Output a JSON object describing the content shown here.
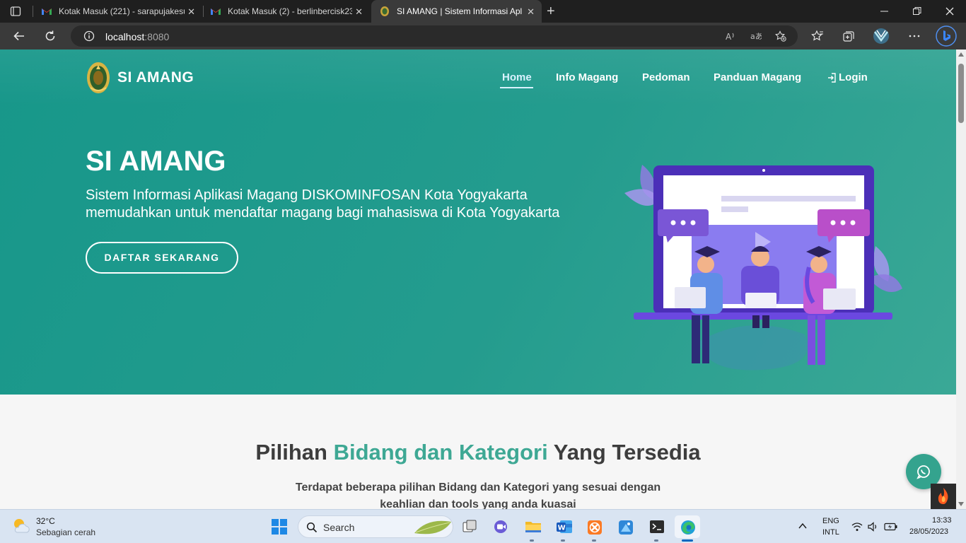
{
  "browser": {
    "tabs": [
      {
        "title": "Kotak Masuk (221) - sarapujakesu",
        "icon": "gmail-icon"
      },
      {
        "title": "Kotak Masuk (2) - berlinbercisk23",
        "icon": "gmail-icon"
      },
      {
        "title": "SI AMANG | Sistem Informasi Apl",
        "icon": "jogja-crest-icon"
      }
    ],
    "close_glyph": "✕",
    "new_tab_glyph": "+",
    "url_host": "localhost",
    "url_port": ":8080"
  },
  "page": {
    "brand": "SI AMANG",
    "nav": {
      "home": "Home",
      "info": "Info Magang",
      "pedoman": "Pedoman",
      "panduan": "Panduan Magang",
      "login": "Login"
    },
    "hero": {
      "title": "SI AMANG",
      "subtitle": "Sistem Informasi Aplikasi Magang DISKOMINFOSAN Kota Yogyakarta memudahkan untuk mendaftar magang bagi mahasiswa di Kota Yogyakarta",
      "cta": "DAFTAR SEKARANG"
    },
    "section": {
      "title_pre": "Pilihan ",
      "title_accent": "Bidang dan Kategori",
      "title_post": " Yang Tersedia",
      "desc": "Terdapat beberapa pilihan Bidang dan Kategori yang sesuai dengan keahlian dan tools yang anda kuasai"
    },
    "colors": {
      "primary": "#249c8e",
      "accent": "#3ea894"
    }
  },
  "taskbar": {
    "weather_temp": "32°C",
    "weather_desc": "Sebagian cerah",
    "search_label": "Search",
    "lang_1": "ENG",
    "lang_2": "INTL",
    "time": "13:33",
    "date": "28/05/2023"
  }
}
